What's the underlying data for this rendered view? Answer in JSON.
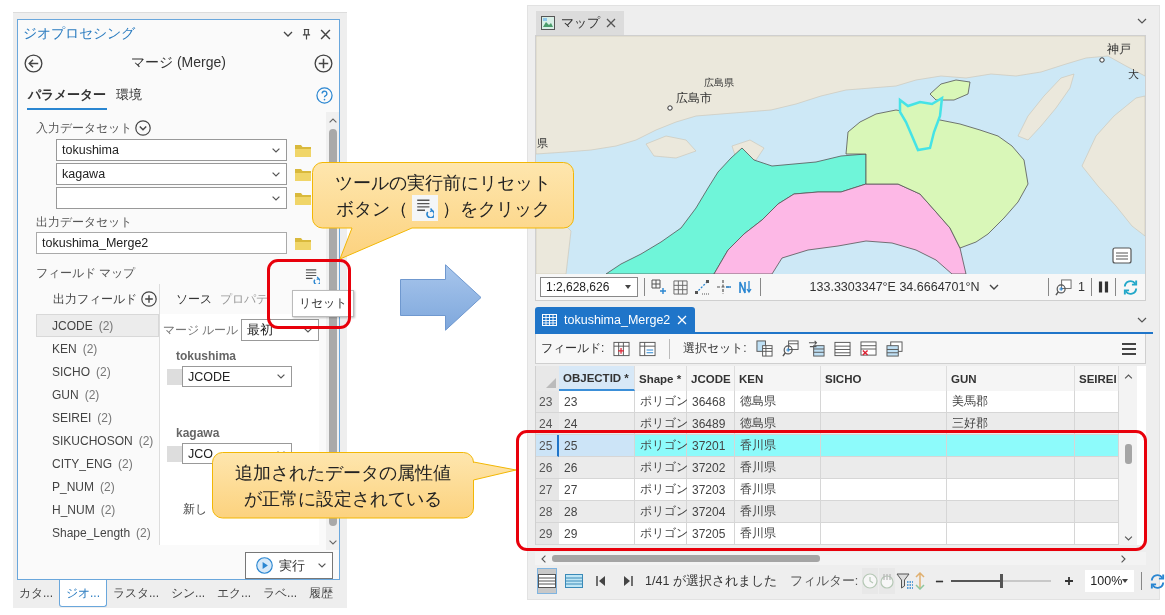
{
  "geoprocessing": {
    "title": "ジオプロセシング",
    "tool_title": "マージ (Merge)",
    "tabs": [
      {
        "label": "パラメーター",
        "selected": true
      },
      {
        "label": "環境",
        "selected": false
      }
    ],
    "input_datasets": {
      "label": "入力データセット",
      "rows": [
        {
          "kind": "filled",
          "value": "tokushima"
        },
        {
          "kind": "filled",
          "value": "kagawa"
        },
        {
          "kind": "empty"
        }
      ]
    },
    "output_dataset": {
      "label": "出力データセット",
      "value": "tokushima_Merge2"
    },
    "field_map": {
      "label": "フィールド マップ",
      "reset_tooltip": "リセット",
      "output_fields_label": "出力フィールド",
      "fields": [
        {
          "name": "JCODE",
          "count": "(2)",
          "selected": true
        },
        {
          "name": "KEN",
          "count": "(2)",
          "selected": false
        },
        {
          "name": "SICHO",
          "count": "(2)",
          "selected": false
        },
        {
          "name": "GUN",
          "count": "(2)",
          "selected": false
        },
        {
          "name": "SEIREI",
          "count": "(2)",
          "selected": false
        },
        {
          "name": "SIKUCHOSON",
          "count": "(2)",
          "selected": false
        },
        {
          "name": "CITY_ENG",
          "count": "(2)",
          "selected": false
        },
        {
          "name": "P_NUM",
          "count": "(2)",
          "selected": false
        },
        {
          "name": "H_NUM",
          "count": "(2)",
          "selected": false
        },
        {
          "name": "Shape_Length",
          "count": "(2)",
          "selected": false
        }
      ],
      "source_tabs": [
        {
          "label": "ソース",
          "selected": true
        },
        {
          "label": "プロパテ",
          "selected": false
        }
      ],
      "merge_rule": {
        "label": "マージ ルール",
        "value": "最初"
      },
      "sources": [
        {
          "dataset": "tokushima",
          "field": "JCODE"
        },
        {
          "dataset": "kagawa",
          "field": "JCO"
        }
      ],
      "new_field_label": "新し"
    },
    "run_button": "実行"
  },
  "dock_tabs": [
    {
      "label": "カタ...",
      "selected": false
    },
    {
      "label": "ジオ...",
      "selected": true
    },
    {
      "label": "ラスタ...",
      "selected": false
    },
    {
      "label": "シン...",
      "selected": false
    },
    {
      "label": "エク...",
      "selected": false
    },
    {
      "label": "ラベ...",
      "selected": false
    },
    {
      "label": "履歴",
      "selected": false
    }
  ],
  "map_view": {
    "tab": "マップ",
    "labels": [
      "広島県",
      "広島市",
      "神戸",
      "大",
      "県"
    ],
    "scale": "1:2,628,626",
    "coordinates": "133.3303347°E 34.6664701°N",
    "selection_count": "1"
  },
  "table_view": {
    "tab": "tokushima_Merge2",
    "fields_label": "フィールド:",
    "selection_label": "選択セット:",
    "columns": [
      {
        "label": "OBJECTID *",
        "selected": true
      },
      {
        "label": "Shape *",
        "selected": false
      },
      {
        "label": "JCODE",
        "selected": false
      },
      {
        "label": "KEN",
        "selected": false
      },
      {
        "label": "SICHO",
        "selected": false
      },
      {
        "label": "GUN",
        "selected": false
      },
      {
        "label": "SEIREI",
        "selected": false
      }
    ],
    "rows": [
      {
        "number": "23",
        "objectid": "23",
        "shape": "ポリゴン",
        "jcode": "36468",
        "ken": "徳島県",
        "gun": "美馬郡",
        "selected": false
      },
      {
        "number": "24",
        "objectid": "24",
        "shape": "ポリゴン",
        "jcode": "36489",
        "ken": "徳島県",
        "gun": "三好郡",
        "selected": false
      },
      {
        "number": "25",
        "objectid": "25",
        "shape": "ポリゴン",
        "jcode": "37201",
        "ken": "香川県",
        "selected": true
      },
      {
        "number": "26",
        "objectid": "26",
        "shape": "ポリゴン",
        "jcode": "37202",
        "ken": "香川県",
        "selected": false
      },
      {
        "number": "27",
        "objectid": "27",
        "shape": "ポリゴン",
        "jcode": "37203",
        "ken": "香川県",
        "selected": false
      },
      {
        "number": "28",
        "objectid": "28",
        "shape": "ポリゴン",
        "jcode": "37204",
        "ken": "香川県",
        "selected": false
      },
      {
        "number": "29",
        "objectid": "29",
        "shape": "ポリゴン",
        "jcode": "37205",
        "ken": "香川県",
        "selected": false
      }
    ],
    "record_views": [
      {
        "kind": "all",
        "selected": true
      },
      {
        "kind": "selected",
        "selected": false
      }
    ],
    "status": "1/41 が選択されました",
    "filter_label": "フィルター:",
    "filter_buttons": [
      {
        "kind": "time",
        "disabled": true
      },
      {
        "kind": "range",
        "disabled": true
      },
      {
        "kind": "extent",
        "disabled": false
      },
      {
        "kind": "arrows",
        "disabled": false
      }
    ],
    "zoom_slider": {
      "level": 0.5
    },
    "zoom_percent": "100%"
  },
  "annotations": [
    {
      "kind": "icon_text",
      "text_1": "ツールの実行前にリセット",
      "text_2": "ボタン（",
      "text_3": "）をクリック"
    },
    {
      "kind": "text",
      "text": "追加されたデータの属性値が正常に設定されている"
    }
  ]
}
